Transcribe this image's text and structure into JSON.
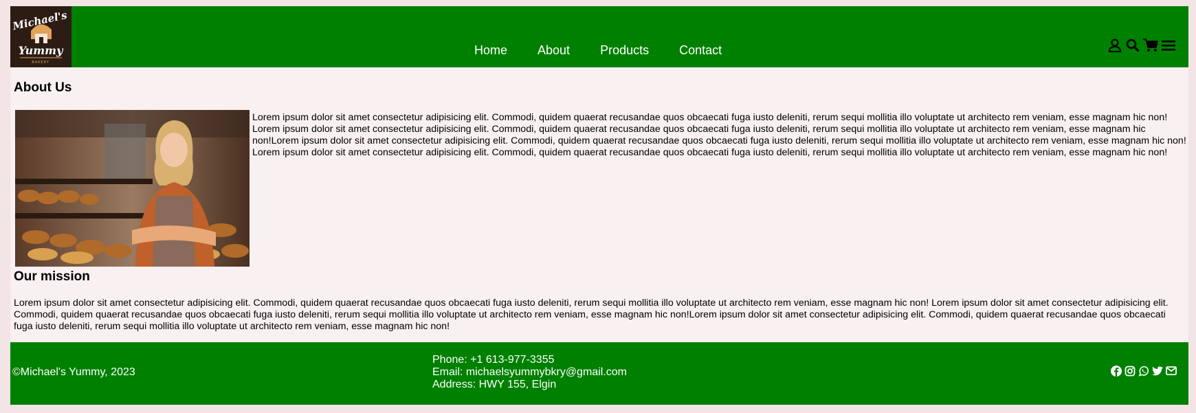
{
  "brand": {
    "logo_top": "Michael's",
    "logo_bottom": "Yummy",
    "logo_sub": "BAKERY"
  },
  "nav": {
    "items": [
      {
        "label": "Home"
      },
      {
        "label": "About"
      },
      {
        "label": "Products"
      },
      {
        "label": "Contact"
      }
    ]
  },
  "header_icons": [
    "user-icon",
    "search-icon",
    "cart-icon",
    "menu-icon"
  ],
  "about": {
    "title": "About Us",
    "text": "Lorem ipsum dolor sit amet consectetur adipisicing elit. Commodi, quidem quaerat recusandae quos obcaecati fuga iusto deleniti, rerum sequi mollitia illo voluptate ut architecto rem veniam, esse magnam hic non! Lorem ipsum dolor sit amet consectetur adipisicing elit. Commodi, quidem quaerat recusandae quos obcaecati fuga iusto deleniti, rerum sequi mollitia illo voluptate ut architecto rem veniam, esse magnam hic non!Lorem ipsum dolor sit amet consectetur adipisicing elit. Commodi, quidem quaerat recusandae quos obcaecati fuga iusto deleniti, rerum sequi mollitia illo voluptate ut architecto rem veniam, esse magnam hic non! Lorem ipsum dolor sit amet consectetur adipisicing elit. Commodi, quidem quaerat recusandae quos obcaecati fuga iusto deleniti, rerum sequi mollitia illo voluptate ut architecto rem veniam, esse magnam hic non!"
  },
  "mission": {
    "title": "Our mission",
    "text": "Lorem ipsum dolor sit amet consectetur adipisicing elit. Commodi, quidem quaerat recusandae quos obcaecati fuga iusto deleniti, rerum sequi mollitia illo voluptate ut architecto rem veniam, esse magnam hic non! Lorem ipsum dolor sit amet consectetur adipisicing elit. Commodi, quidem quaerat recusandae quos obcaecati fuga iusto deleniti, rerum sequi mollitia illo voluptate ut architecto rem veniam, esse magnam hic non!Lorem ipsum dolor sit amet consectetur adipisicing elit. Commodi, quidem quaerat recusandae quos obcaecati fuga iusto deleniti, rerum sequi mollitia illo voluptate ut architecto rem veniam, esse magnam hic non!"
  },
  "footer": {
    "copyright": "©Michael's Yummy, 2023",
    "phone": "Phone: +1 613-977-3355",
    "email": "Email: michaelsyummybkry@gmail.com",
    "address": "Address: HWY 155, Elgin"
  },
  "social_icons": [
    "facebook-icon",
    "instagram-icon",
    "whatsapp-icon",
    "twitter-icon",
    "mail-icon"
  ],
  "colors": {
    "header_footer": "#008000",
    "page_bg": "#f3e4e6",
    "content_bg": "#f8f0f1",
    "logo_bg": "#2c1c14"
  }
}
